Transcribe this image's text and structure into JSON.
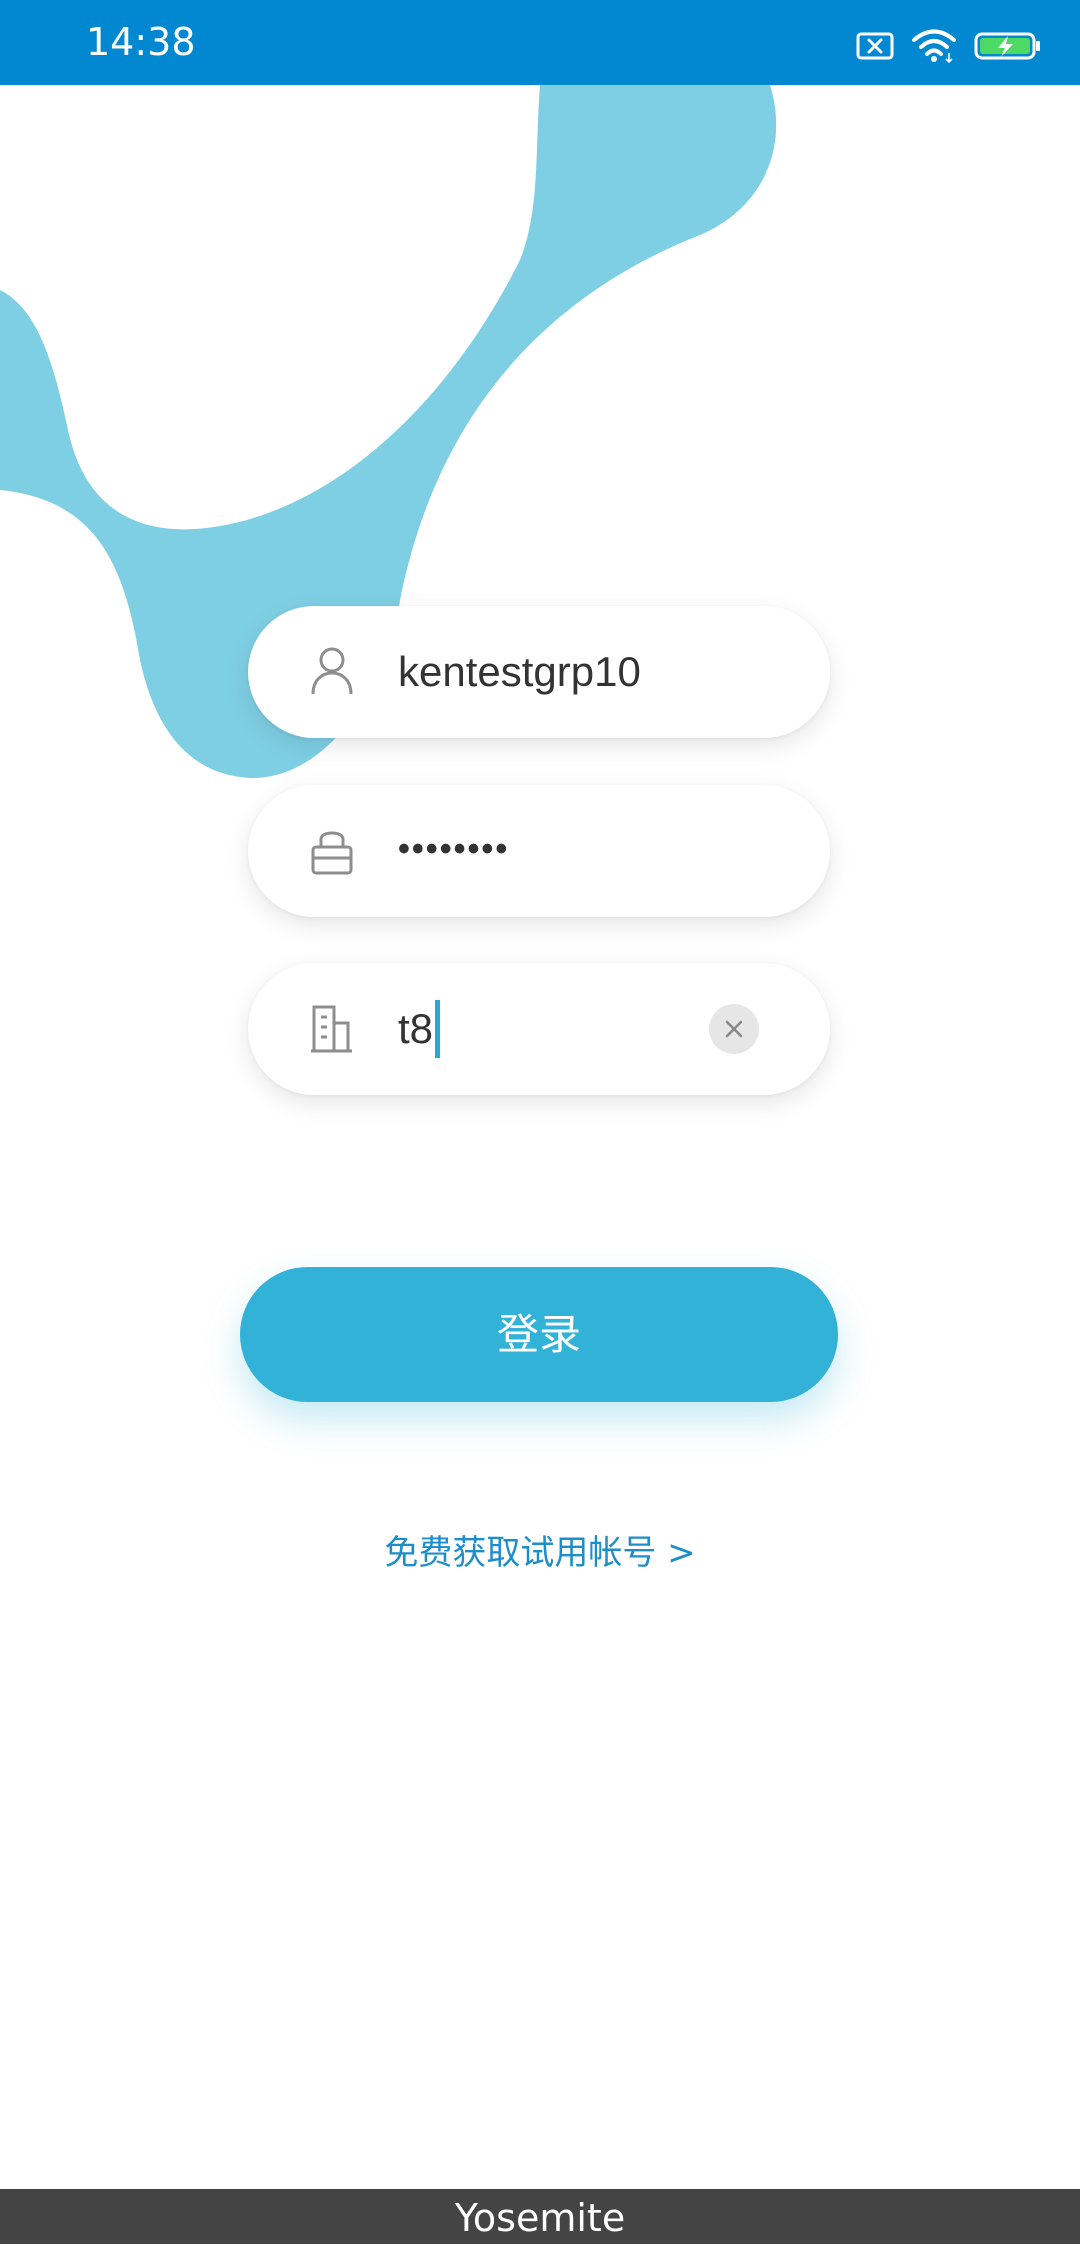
{
  "status_bar": {
    "time": "14:38",
    "icons": [
      "sim-error-icon",
      "wifi-icon",
      "battery-charging-icon"
    ]
  },
  "form": {
    "username": {
      "value": "kentestgrp10",
      "icon": "user-icon"
    },
    "password": {
      "value": "••••••••",
      "icon": "lock-icon"
    },
    "company": {
      "value": "t8",
      "icon": "building-icon",
      "clear_icon": "close-icon"
    }
  },
  "login_button": {
    "label": "登录"
  },
  "trial_link": {
    "label": "免费获取试用帐号 >"
  },
  "bottom_bar": {
    "label": "Yosemite"
  },
  "colors": {
    "status_bar": "#0288d1",
    "blob": "#7fcfe4",
    "button": "#33b2d8",
    "link": "#1d8ec9",
    "bottom_bar": "#444444"
  }
}
